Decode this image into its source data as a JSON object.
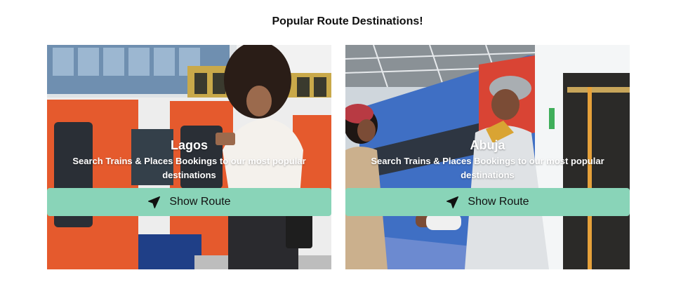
{
  "header": {
    "title": "Popular Route Destinations!"
  },
  "cards": [
    {
      "city": "Lagos",
      "description": "Search Trains & Places Bookings to our most popular destinations",
      "button_label": "Show Route",
      "button_icon": "paper-plane-icon",
      "photo": "woman-with-phone-beside-red-white-blue-train"
    },
    {
      "city": "Abuja",
      "description": "Search Trains & Places Bookings to our most popular destinations",
      "button_label": "Show Route",
      "button_icon": "paper-plane-icon",
      "photo": "two-women-greeting-beside-blue-train"
    }
  ],
  "colors": {
    "button_bg": "#89d4b8",
    "button_text": "#111111",
    "overlay_text": "#ffffff"
  }
}
